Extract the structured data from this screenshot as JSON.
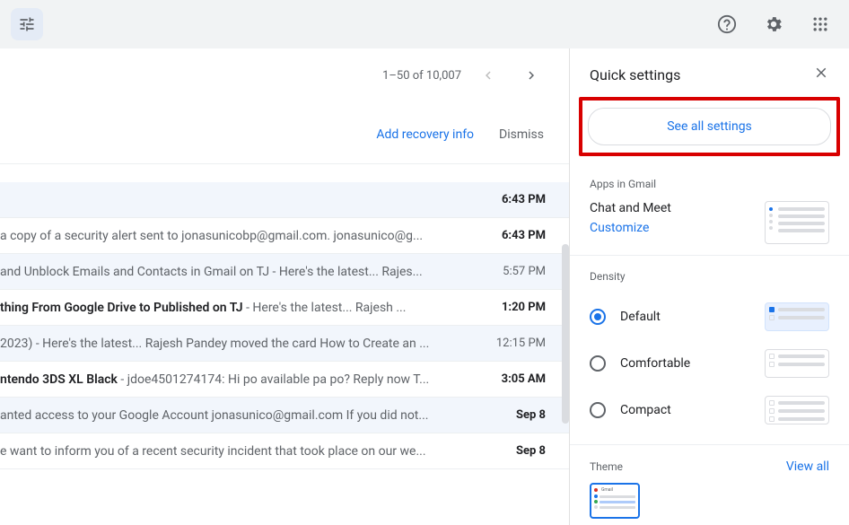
{
  "topbar": {
    "tune_icon": "tune"
  },
  "pagination": {
    "range": "1–50 of 10,007"
  },
  "banner": {
    "action": "Add recovery info",
    "dismiss": "Dismiss"
  },
  "emails": [
    {
      "bold": "",
      "rest": "",
      "time": "6:43 PM",
      "unread": true,
      "shaded": true
    },
    {
      "bold": "",
      "rest": "a copy of a security alert sent to jonasunicobp@gmail.com. jonasunico@g...",
      "time": "6:43 PM",
      "unread": true,
      "shaded": false
    },
    {
      "bold": "",
      "rest": " and Unblock Emails and Contacts in Gmail on TJ - Here's the latest... Rajes...",
      "time": "5:57 PM",
      "unread": false,
      "shaded": true
    },
    {
      "bold": "thing From Google Drive to Published on TJ",
      "rest": " - Here's the latest... Rajesh ...",
      "time": "1:20 PM",
      "unread": true,
      "shaded": false
    },
    {
      "bold": "2023)",
      "rest": " - Here's the latest... Rajesh Pandey moved the card How to Create an ...",
      "time": "12:15 PM",
      "unread": false,
      "shaded": true
    },
    {
      "bold": "ntendo 3DS XL Black",
      "rest": " - jdoe4501274174: Hi po available pa po? Reply now T...",
      "time": "3:05 AM",
      "unread": true,
      "shaded": false
    },
    {
      "bold": "",
      "rest": "anted access to your Google Account jonasunico@gmail.com If you did not...",
      "time": "Sep 8",
      "unread": true,
      "shaded": true
    },
    {
      "bold": "",
      "rest": "e want to inform you of a recent security incident that took place on our we...",
      "time": "Sep 8",
      "unread": true,
      "shaded": false
    }
  ],
  "quick_settings": {
    "title": "Quick settings",
    "see_all": "See all settings",
    "apps_section_title": "Apps in Gmail",
    "chat_label": "Chat and Meet",
    "customize": "Customize",
    "density_title": "Density",
    "density_options": [
      {
        "label": "Default",
        "checked": true
      },
      {
        "label": "Comfortable",
        "checked": false
      },
      {
        "label": "Compact",
        "checked": false
      }
    ],
    "theme_title": "Theme",
    "view_all": "View all"
  }
}
